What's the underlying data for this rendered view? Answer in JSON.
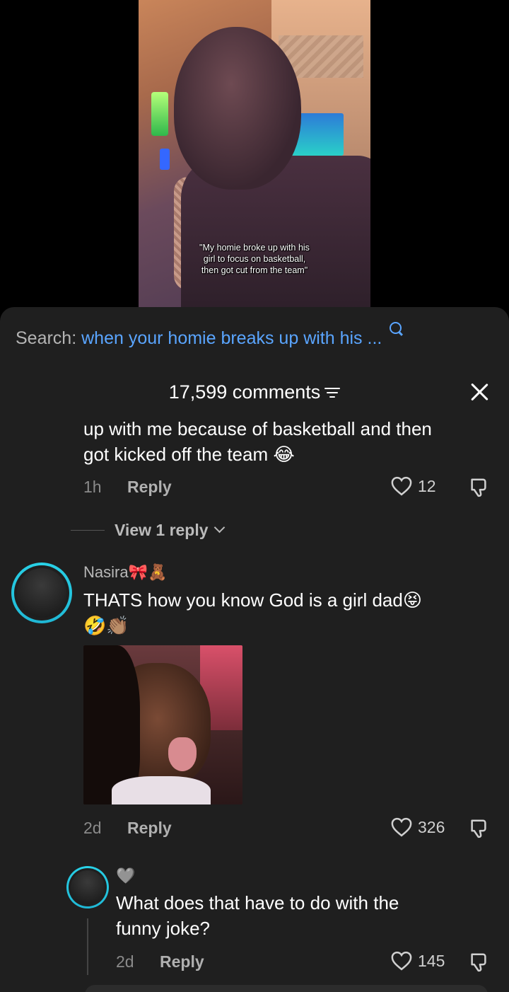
{
  "video": {
    "caption_lines": [
      "\"My homie broke up with his",
      "girl to focus on basketball,",
      "then got cut from the team\""
    ]
  },
  "search": {
    "label": "Search:",
    "query": "when your homie breaks up with his ..."
  },
  "header": {
    "count": "17,599 comments"
  },
  "comments": [
    {
      "text_line1": "up with me because of basketball and then",
      "text_line2": "got kicked off the team 😂",
      "time": "1h",
      "reply_label": "Reply",
      "likes": "12",
      "view_replies": "View 1 reply"
    },
    {
      "username": "Nasira🎀🧸",
      "text_line1": "THATS how you know God is a girl dad😝",
      "text_line2": "🤣👏🏽",
      "time": "2d",
      "reply_label": "Reply",
      "likes": "326"
    },
    {
      "username": "🩶",
      "text_line1": "What does that have to do with the",
      "text_line2": "funny joke?",
      "time": "2d",
      "reply_label": "Reply",
      "likes": "145"
    }
  ],
  "icons": {
    "search": "search-icon",
    "filter": "filter-icon",
    "close": "close-icon",
    "heart": "heart-icon",
    "dislike": "dislike-icon"
  },
  "colors": {
    "accent_blue": "#5aa5ff",
    "avatar_ring": "#29d3e8",
    "sheet_bg": "#1f1f1f"
  }
}
